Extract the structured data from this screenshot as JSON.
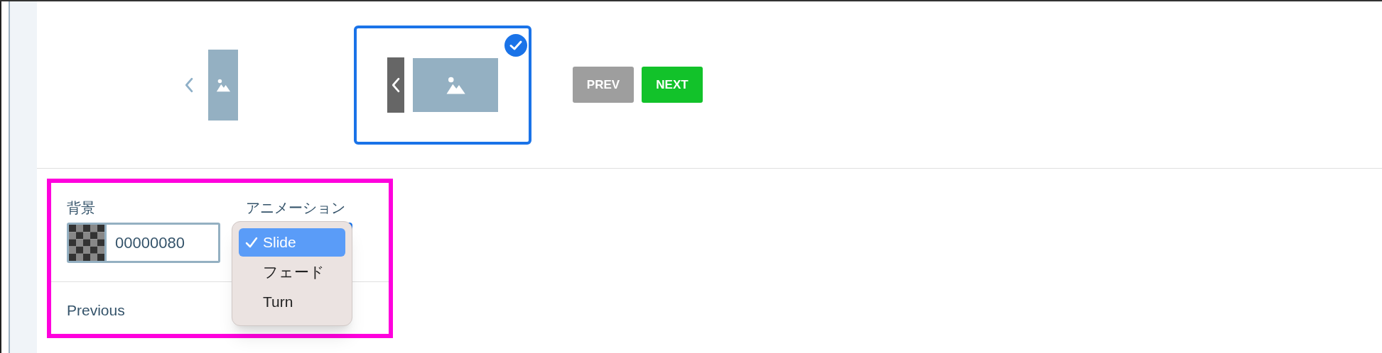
{
  "layout_options": [
    {
      "kind": "narrow",
      "selected": false
    },
    {
      "kind": "wide",
      "selected": true
    }
  ],
  "nav_buttons": [
    {
      "label": "PREV",
      "disabled": true
    },
    {
      "label": "NEXT",
      "disabled": false
    }
  ],
  "background": {
    "label": "背景",
    "value": "00000080"
  },
  "animation": {
    "label": "アニメーション",
    "options": [
      {
        "label": "Slide",
        "selected": true
      },
      {
        "label": "フェード",
        "selected": false
      },
      {
        "label": "Turn",
        "selected": false
      }
    ]
  },
  "section_label": "Previous"
}
